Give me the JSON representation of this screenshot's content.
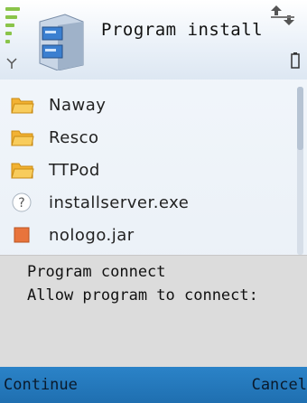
{
  "header": {
    "title": "Program install",
    "icons": [
      "signal-strength-icon",
      "app-installer-icon",
      "data-transfer-icon",
      "battery-icon"
    ]
  },
  "list": {
    "items": [
      {
        "label": "Naway",
        "icon": "folder-icon"
      },
      {
        "label": "Resco",
        "icon": "folder-icon"
      },
      {
        "label": "TTPod",
        "icon": "folder-icon"
      },
      {
        "label": "installserver.exe",
        "icon": "unknown-file-icon"
      },
      {
        "label": "nologo.jar",
        "icon": "java-file-icon"
      }
    ]
  },
  "dialog": {
    "title": "Program connect",
    "message": "Allow program to connect:"
  },
  "softkeys": {
    "left": "Continue",
    "right": "Cancel"
  },
  "colors": {
    "softkey_bar": "#1f6fb0",
    "dialog_bg": "#dcdcdc",
    "folder": "#f2b233",
    "signal": "#8ac44a"
  }
}
